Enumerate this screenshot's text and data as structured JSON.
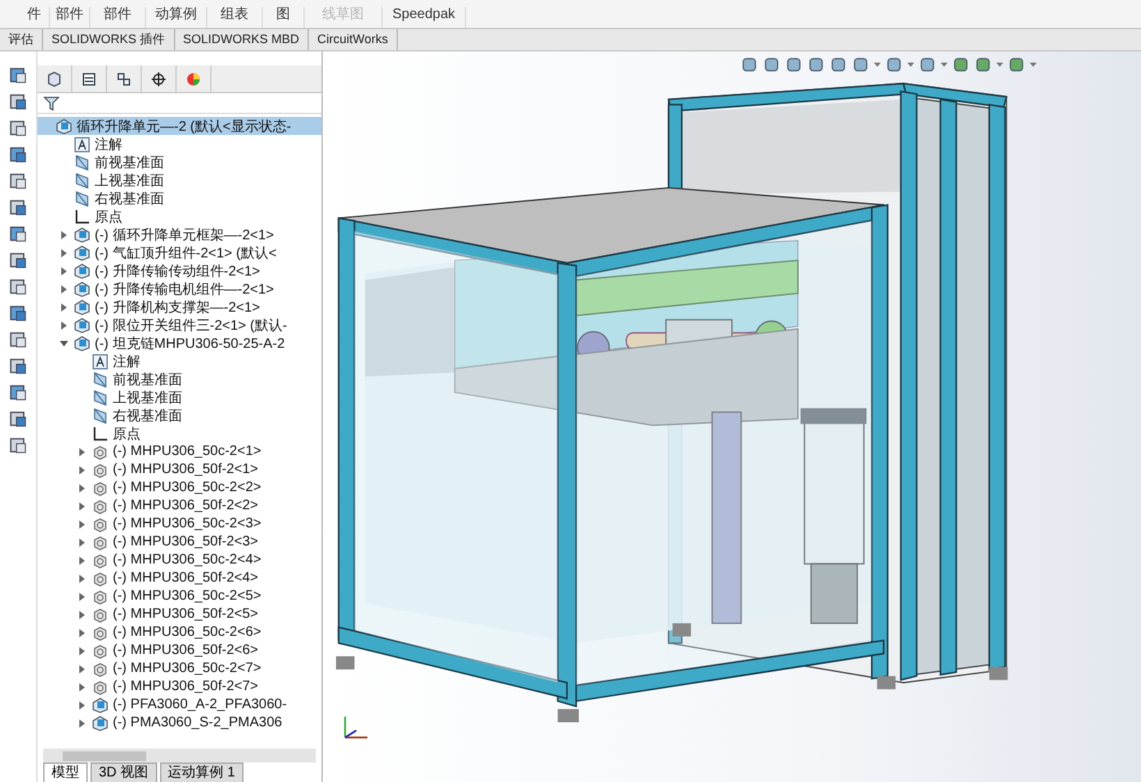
{
  "ribbon": {
    "buttons": [
      {
        "label": "件",
        "disabled": false
      },
      {
        "label": "部件",
        "disabled": false
      },
      {
        "label": "部件",
        "disabled": false
      },
      {
        "label": "动算例",
        "disabled": false
      },
      {
        "label": "组表",
        "disabled": false
      },
      {
        "label": "图",
        "disabled": false
      },
      {
        "label": "线草图",
        "disabled": true
      },
      {
        "label": "Speedpak",
        "disabled": false
      }
    ]
  },
  "command_tabs": [
    "评估",
    "SOLIDWORKS 插件",
    "SOLIDWORKS MBD",
    "CircuitWorks"
  ],
  "tree": {
    "items": [
      {
        "label": "循环升降单元—-2  (默认<显示状态-",
        "kind": "assembly",
        "selected": true,
        "children": [
          {
            "label": "注解",
            "kind": "annotation",
            "selected": false
          },
          {
            "label": "前视基准面",
            "kind": "plane",
            "selected": false
          },
          {
            "label": "上视基准面",
            "kind": "plane",
            "selected": false
          },
          {
            "label": "右视基准面",
            "kind": "plane",
            "selected": false
          },
          {
            "label": "原点",
            "kind": "origin",
            "selected": false
          },
          {
            "label": "(-) 循环升降单元框架—-2<1>",
            "kind": "assembly",
            "selected": false,
            "expanded": false
          },
          {
            "label": "(-) 气缸顶升组件-2<1> (默认<",
            "kind": "assembly",
            "selected": false,
            "expanded": false
          },
          {
            "label": "(-) 升降传输传动组件-2<1>",
            "kind": "assembly",
            "selected": false,
            "expanded": false
          },
          {
            "label": "(-) 升降传输电机组件—-2<1>",
            "kind": "assembly",
            "selected": false,
            "expanded": false
          },
          {
            "label": "(-) 升降机构支撑架—-2<1>",
            "kind": "assembly",
            "selected": false,
            "expanded": false
          },
          {
            "label": "(-) 限位开关组件三-2<1> (默认-",
            "kind": "assembly",
            "selected": false,
            "expanded": false
          },
          {
            "label": "(-) 坦克链MHPU306-50-25-A-2",
            "kind": "assembly",
            "selected": false,
            "expanded": true,
            "children": [
              {
                "label": "注解",
                "kind": "annotation",
                "selected": false
              },
              {
                "label": "前视基准面",
                "kind": "plane",
                "selected": false
              },
              {
                "label": "上视基准面",
                "kind": "plane",
                "selected": false
              },
              {
                "label": "右视基准面",
                "kind": "plane",
                "selected": false
              },
              {
                "label": "原点",
                "kind": "origin",
                "selected": false
              },
              {
                "label": "(-) MHPU306_50c-2<1>",
                "kind": "part",
                "selected": false,
                "expanded": false
              },
              {
                "label": "(-) MHPU306_50f-2<1>",
                "kind": "part",
                "selected": false,
                "expanded": false
              },
              {
                "label": "(-) MHPU306_50c-2<2>",
                "kind": "part",
                "selected": false,
                "expanded": false
              },
              {
                "label": "(-) MHPU306_50f-2<2>",
                "kind": "part",
                "selected": false,
                "expanded": false
              },
              {
                "label": "(-) MHPU306_50c-2<3>",
                "kind": "part",
                "selected": false,
                "expanded": false
              },
              {
                "label": "(-) MHPU306_50f-2<3>",
                "kind": "part",
                "selected": false,
                "expanded": false
              },
              {
                "label": "(-) MHPU306_50c-2<4>",
                "kind": "part",
                "selected": false,
                "expanded": false
              },
              {
                "label": "(-) MHPU306_50f-2<4>",
                "kind": "part",
                "selected": false,
                "expanded": false
              },
              {
                "label": "(-) MHPU306_50c-2<5>",
                "kind": "part",
                "selected": false,
                "expanded": false
              },
              {
                "label": "(-) MHPU306_50f-2<5>",
                "kind": "part",
                "selected": false,
                "expanded": false
              },
              {
                "label": "(-) MHPU306_50c-2<6>",
                "kind": "part",
                "selected": false,
                "expanded": false
              },
              {
                "label": "(-) MHPU306_50f-2<6>",
                "kind": "part",
                "selected": false,
                "expanded": false
              },
              {
                "label": "(-) MHPU306_50c-2<7>",
                "kind": "part",
                "selected": false,
                "expanded": false
              },
              {
                "label": "(-) MHPU306_50f-2<7>",
                "kind": "part",
                "selected": false,
                "expanded": false
              },
              {
                "label": "(-) PFA3060_A-2_PFA3060-",
                "kind": "assembly",
                "selected": false,
                "expanded": false
              },
              {
                "label": "(-) PMA3060_S-2_PMA306",
                "kind": "assembly",
                "selected": false,
                "expanded": false
              }
            ]
          }
        ]
      }
    ]
  },
  "bottom_tabs": [
    {
      "label": "模型",
      "selected": true
    },
    {
      "label": "3D 视图",
      "selected": false
    },
    {
      "label": "运动算例 1",
      "selected": false
    }
  ]
}
